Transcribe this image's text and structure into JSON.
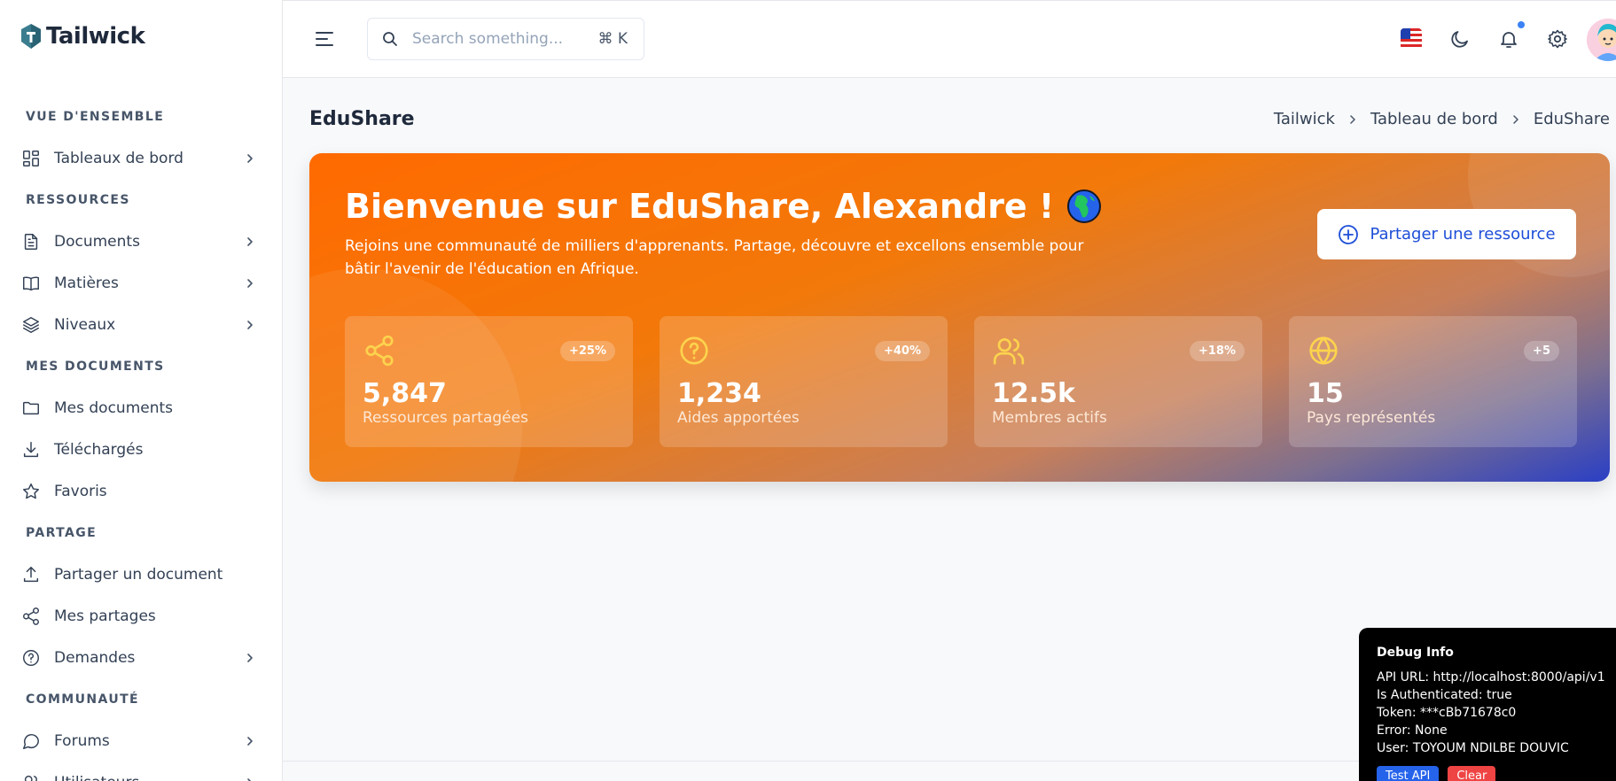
{
  "brand": {
    "name": "Tailwick"
  },
  "sidebar": {
    "sections": [
      {
        "heading": "VUE D'ENSEMBLE",
        "items": [
          {
            "label": "Tableaux de bord",
            "icon": "dashboard-icon",
            "chevron": true
          }
        ]
      },
      {
        "heading": "RESSOURCES",
        "items": [
          {
            "label": "Documents",
            "icon": "document-icon",
            "chevron": true
          },
          {
            "label": "Matières",
            "icon": "book-icon",
            "chevron": true
          },
          {
            "label": "Niveaux",
            "icon": "layers-icon",
            "chevron": true
          }
        ]
      },
      {
        "heading": "MES DOCUMENTS",
        "items": [
          {
            "label": "Mes documents",
            "icon": "folder-icon",
            "chevron": false
          },
          {
            "label": "Téléchargés",
            "icon": "download-icon",
            "chevron": false
          },
          {
            "label": "Favoris",
            "icon": "star-icon",
            "chevron": false
          }
        ]
      },
      {
        "heading": "PARTAGE",
        "items": [
          {
            "label": "Partager un document",
            "icon": "upload-icon",
            "chevron": false
          },
          {
            "label": "Mes partages",
            "icon": "share-icon",
            "chevron": false
          },
          {
            "label": "Demandes",
            "icon": "help-circle-icon",
            "chevron": true
          }
        ]
      },
      {
        "heading": "COMMUNAUTÉ",
        "items": [
          {
            "label": "Forums",
            "icon": "chat-icon",
            "chevron": true
          },
          {
            "label": "Utilisateurs",
            "icon": "users-icon",
            "chevron": true
          }
        ]
      }
    ]
  },
  "header": {
    "search_placeholder": "Search something...",
    "shortcut": "⌘ K"
  },
  "page": {
    "title": "EduShare",
    "breadcrumb": [
      "Tailwick",
      "Tableau de bord",
      "EduShare"
    ]
  },
  "hero": {
    "title": "Bienvenue sur EduShare, Alexandre !",
    "description": "Rejoins une communauté de milliers d'apprenants. Partage, découvre et excellons ensemble pour bâtir l'avenir de l'éducation en Afrique.",
    "button_label": "Partager une ressource",
    "stats": [
      {
        "value": "5,847",
        "label": "Ressources partagées",
        "badge": "+25%",
        "icon": "share-icon"
      },
      {
        "value": "1,234",
        "label": "Aides apportées",
        "badge": "+40%",
        "icon": "help-circle-icon"
      },
      {
        "value": "12.5k",
        "label": "Membres actifs",
        "badge": "+18%",
        "icon": "users-icon"
      },
      {
        "value": "15",
        "label": "Pays représentés",
        "badge": "+5",
        "icon": "globe-icon"
      }
    ]
  },
  "debug": {
    "title": "Debug Info",
    "lines": [
      "API URL: http://localhost:8000/api/v1",
      "Is Authenticated: true",
      "Token: ***cBb71678c0",
      "Error: None",
      "User: TOYOUM NDILBE DOUVIC"
    ],
    "test_label": "Test API",
    "clear_label": "Clear"
  },
  "colors": {
    "accent": "#1d4ed8",
    "hero_start": "#ff6a00",
    "hero_end": "#2a3fc4",
    "stat_icon": "#fcd34d"
  }
}
